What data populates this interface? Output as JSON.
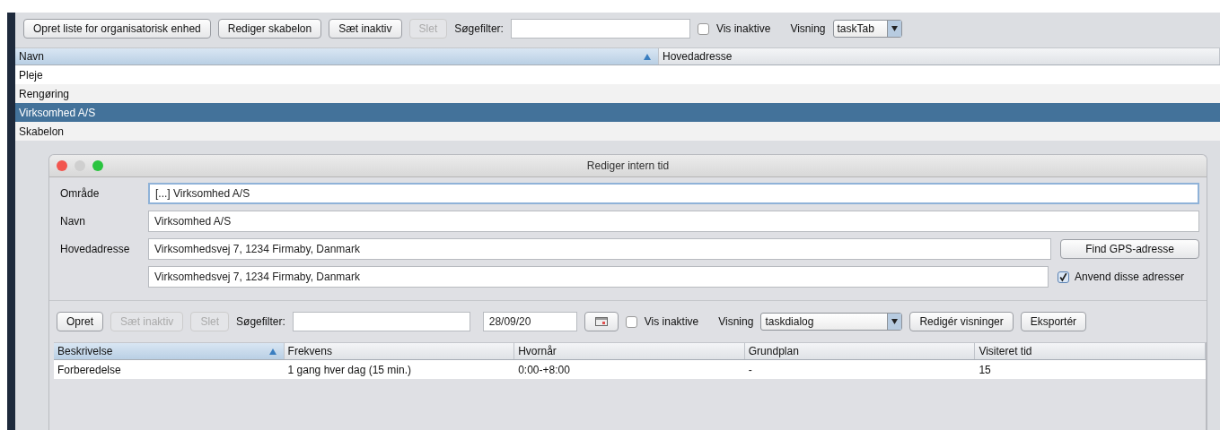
{
  "toolbar": {
    "buttons": [
      {
        "label": "Opret liste for organisatorisk enhed",
        "disabled": false
      },
      {
        "label": "Rediger skabelon",
        "disabled": false
      },
      {
        "label": "Sæt inaktiv",
        "disabled": false
      },
      {
        "label": "Slet",
        "disabled": true
      }
    ],
    "search": {
      "label": "Søgefilter:"
    },
    "show_inactive": {
      "label": "Vis inaktive",
      "checked": false
    },
    "view": {
      "label": "Visning",
      "value": "taskTab"
    }
  },
  "table": {
    "columns": [
      {
        "label": "Navn",
        "sorted": true
      },
      {
        "label": "Hovedadresse",
        "sorted": false
      }
    ],
    "rows": [
      {
        "cells": [
          "Pleje",
          ""
        ],
        "selected": false
      },
      {
        "cells": [
          "Rengøring",
          ""
        ],
        "selected": false
      },
      {
        "cells": [
          "Virksomhed A/S",
          ""
        ],
        "selected": true
      },
      {
        "cells": [
          "Skabelon",
          ""
        ],
        "selected": false
      }
    ]
  },
  "dialog": {
    "title": "Rediger intern tid",
    "fields": [
      {
        "label": "Område",
        "value": "[...] Virksomhed A/S",
        "focused": true
      },
      {
        "label": "Navn",
        "value": "Virksomhed A/S",
        "focused": false
      },
      {
        "label": "Hovedadresse",
        "value": "Virksomhedsvej 7, 1234 Firmaby, Danmark",
        "focused": false
      },
      {
        "value": "Virksomhedsvej 7, 1234 Firmaby, Danmark",
        "focused": false
      }
    ],
    "gps_button": "Find GPS-adresse",
    "use_addresses": {
      "label": "Anvend disse adresser",
      "checked": true
    },
    "toolbar": {
      "buttons": [
        {
          "label": "Opret",
          "disabled": false
        },
        {
          "label": "Sæt inaktiv",
          "disabled": true
        },
        {
          "label": "Slet",
          "disabled": true
        }
      ],
      "search": {
        "label": "Søgefilter:"
      },
      "date": "28/09/20",
      "show_inactive": {
        "label": "Vis inaktive",
        "checked": false
      },
      "view": {
        "label": "Visning",
        "value": "taskdialog"
      },
      "extra_buttons": [
        "Redigér visninger",
        "Eksportér"
      ]
    },
    "table": {
      "columns": [
        {
          "label": "Beskrivelse",
          "sorted": true
        },
        {
          "label": "Frekvens",
          "sorted": false
        },
        {
          "label": "Hvornår",
          "sorted": false
        },
        {
          "label": "Grundplan",
          "sorted": false
        },
        {
          "label": "Visiteret tid",
          "sorted": false
        }
      ],
      "rows": [
        {
          "cells": [
            "Forberedelse",
            "1 gang hver dag (15 min.)",
            "0:00-+8:00",
            "-",
            "15"
          ],
          "selected": false
        }
      ]
    }
  }
}
